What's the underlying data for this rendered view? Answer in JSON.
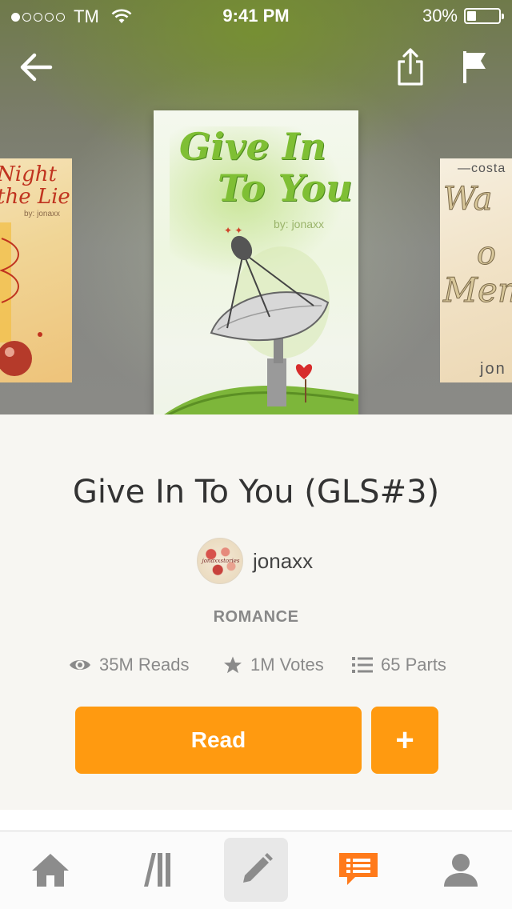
{
  "status_bar": {
    "carrier": "TM",
    "time": "9:41 PM",
    "battery_percent": "30%",
    "battery_level": 0.3,
    "signal_dots_filled": 1,
    "signal_dots_total": 5
  },
  "header": {
    "back_icon": "arrow-left-icon",
    "share_icon": "share-icon",
    "flag_icon": "flag-icon"
  },
  "covers": {
    "left": {
      "title": "Night\nthe Lie",
      "author": "by: jonaxx"
    },
    "main": {
      "title_line1": "Give In",
      "title_line2": "To You",
      "author": "by: jonaxx"
    },
    "right": {
      "top_text": "costa",
      "line1": "Wa",
      "line2": "o",
      "line3": "Mem",
      "author": "jon"
    }
  },
  "book": {
    "title": "Give In To You (GLS#3)",
    "author": "jonaxx",
    "avatar_text": "jonaxxstories",
    "genre": "ROMANCE"
  },
  "stats": {
    "reads": "35M Reads",
    "votes": "1M Votes",
    "parts": "65 Parts"
  },
  "actions": {
    "read_label": "Read",
    "add_label": "+"
  },
  "colors": {
    "accent": "#ff9a10",
    "stat_gray": "#8a8a8a",
    "tab_gray": "#8c8c8c"
  },
  "tabbar": {
    "items": [
      {
        "icon": "home-icon"
      },
      {
        "icon": "library-icon"
      },
      {
        "icon": "pencil-icon",
        "selected": true
      },
      {
        "icon": "messages-icon"
      },
      {
        "icon": "profile-icon"
      }
    ]
  }
}
